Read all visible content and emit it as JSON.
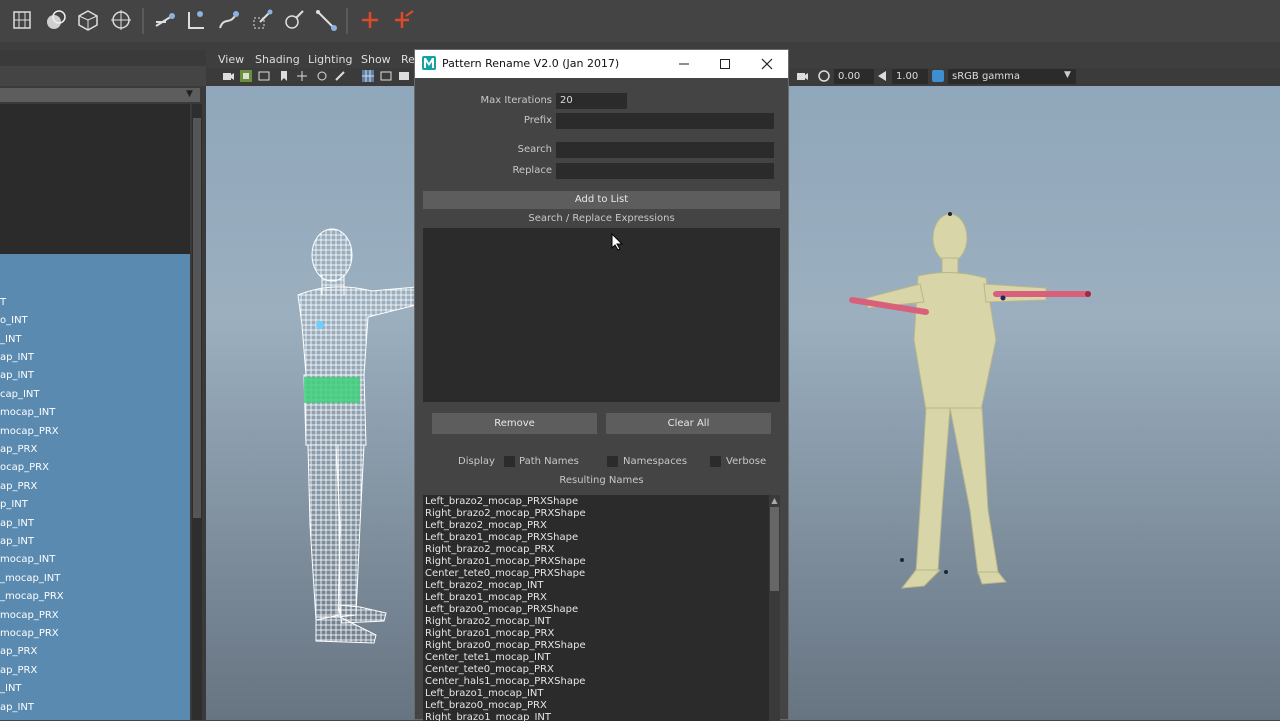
{
  "viewport": {
    "menus": [
      "View",
      "Shading",
      "Lighting",
      "Show",
      "Re"
    ],
    "exposure": "0.00",
    "gamma": "1.00",
    "color_space": "sRGB gamma"
  },
  "outliner": {
    "items": [
      "T",
      "o_INT",
      "_INT",
      "ap_INT",
      "ap_INT",
      "cap_INT",
      "mocap_INT",
      "mocap_PRX",
      "ap_PRX",
      "ocap_PRX",
      "ap_PRX",
      "p_INT",
      "ap_INT",
      "ap_INT",
      "mocap_INT",
      "_mocap_INT",
      "_mocap_PRX",
      "mocap_PRX",
      "mocap_PRX",
      "ap_PRX",
      "ap_PRX",
      "_INT",
      "ap_INT"
    ]
  },
  "dialog": {
    "title": "Pattern Rename V2.0 (Jan 2017)",
    "max_iterations_label": "Max Iterations",
    "max_iterations_value": "20",
    "prefix_label": "Prefix",
    "search_label": "Search",
    "replace_label": "Replace",
    "add_to_list": "Add to List",
    "expressions_label": "Search / Replace Expressions",
    "remove": "Remove",
    "clear_all": "Clear All",
    "display_label": "Display",
    "path_names": "Path Names",
    "namespaces": "Namespaces",
    "verbose": "Verbose",
    "resulting_names_label": "Resulting Names",
    "results": [
      "Left_brazo2_mocap_PRXShape",
      "Right_brazo2_mocap_PRXShape",
      "Left_brazo2_mocap_PRX",
      "Left_brazo1_mocap_PRXShape",
      "Right_brazo2_mocap_PRX",
      "Right_brazo1_mocap_PRXShape",
      "Center_tete0_mocap_PRXShape",
      "Left_brazo2_mocap_INT",
      "Left_brazo1_mocap_PRX",
      "Left_brazo0_mocap_PRXShape",
      "Right_brazo2_mocap_INT",
      "Right_brazo1_mocap_PRX",
      "Right_brazo0_mocap_PRXShape",
      "Center_tete1_mocap_INT",
      "Center_tete0_mocap_PRX",
      "Center_hals1_mocap_PRXShape",
      "Left_brazo1_mocap_INT",
      "Left_brazo0_mocap_PRX",
      "Right_brazo1_mocap_INT"
    ]
  },
  "colors": {
    "shelf_red": "#e04a2a",
    "outliner_selection": "#5a8ab0",
    "viewport_sky": "#9bafbf",
    "bone_pink": "#d9607a",
    "skin": "#d8d6a8"
  }
}
